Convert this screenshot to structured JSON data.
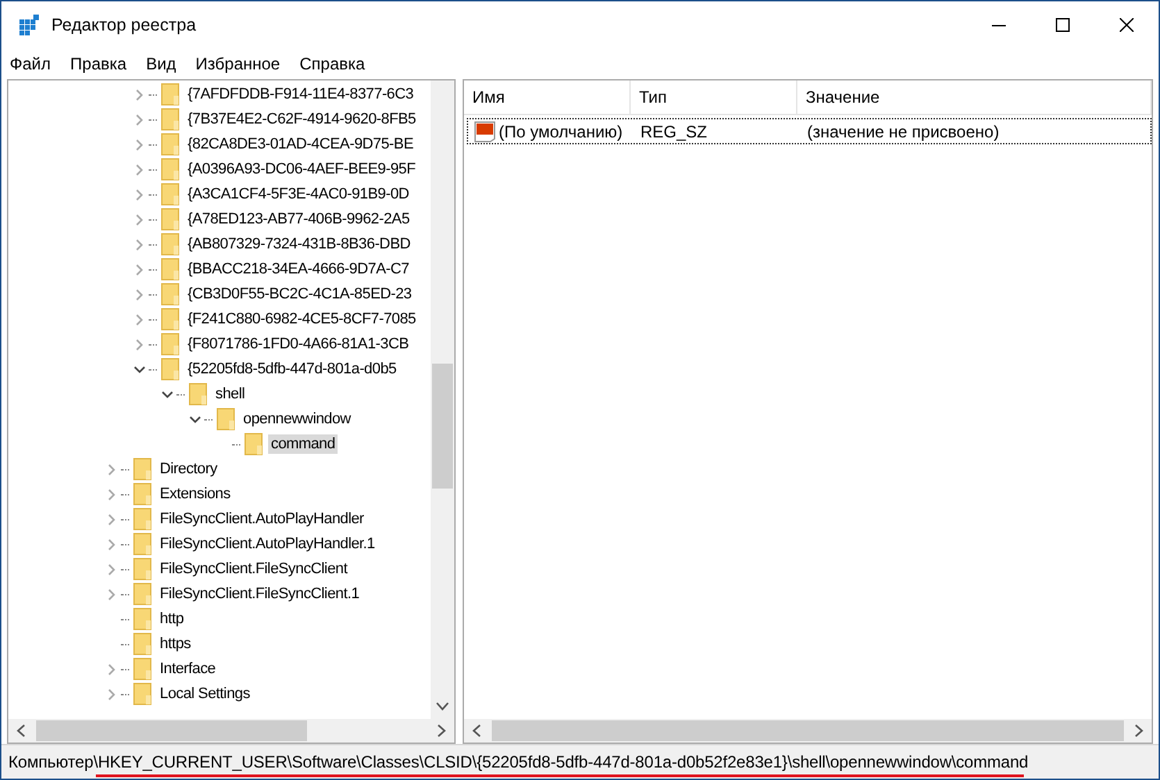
{
  "window": {
    "title": "Редактор реестра"
  },
  "menu": [
    "Файл",
    "Правка",
    "Вид",
    "Избранное",
    "Справка"
  ],
  "tree": {
    "clsid_subkeys": [
      {
        "label": "{7AFDFDDB-F914-11E4-8377-6C3",
        "expandable": true,
        "expanded": false,
        "selected": false
      },
      {
        "label": "{7B37E4E2-C62F-4914-9620-8FB5",
        "expandable": true,
        "expanded": false,
        "selected": false
      },
      {
        "label": "{82CA8DE3-01AD-4CEA-9D75-BE",
        "expandable": true,
        "expanded": false,
        "selected": false
      },
      {
        "label": "{A0396A93-DC06-4AEF-BEE9-95F",
        "expandable": true,
        "expanded": false,
        "selected": false
      },
      {
        "label": "{A3CA1CF4-5F3E-4AC0-91B9-0D",
        "expandable": true,
        "expanded": false,
        "selected": false
      },
      {
        "label": "{A78ED123-AB77-406B-9962-2A5",
        "expandable": true,
        "expanded": false,
        "selected": false
      },
      {
        "label": "{AB807329-7324-431B-8B36-DBD",
        "expandable": true,
        "expanded": false,
        "selected": false
      },
      {
        "label": "{BBACC218-34EA-4666-9D7A-C7",
        "expandable": true,
        "expanded": false,
        "selected": false
      },
      {
        "label": "{CB3D0F55-BC2C-4C1A-85ED-23",
        "expandable": true,
        "expanded": false,
        "selected": false
      },
      {
        "label": "{F241C880-6982-4CE5-8CF7-7085",
        "expandable": true,
        "expanded": false,
        "selected": false
      },
      {
        "label": "{F8071786-1FD0-4A66-81A1-3CB",
        "expandable": true,
        "expanded": false,
        "selected": false
      },
      {
        "label": "{52205fd8-5dfb-447d-801a-d0b5",
        "expandable": true,
        "expanded": true,
        "selected": false,
        "children": [
          {
            "label": "shell",
            "expandable": true,
            "expanded": true,
            "selected": false,
            "children": [
              {
                "label": "opennewwindow",
                "expandable": true,
                "expanded": true,
                "selected": false,
                "children": [
                  {
                    "label": "command",
                    "expandable": false,
                    "selected": true
                  }
                ]
              }
            ]
          }
        ]
      }
    ],
    "class_keys": [
      {
        "label": "Directory",
        "expandable": true,
        "expanded": false,
        "selected": false
      },
      {
        "label": "Extensions",
        "expandable": true,
        "expanded": false,
        "selected": false
      },
      {
        "label": "FileSyncClient.AutoPlayHandler",
        "expandable": true,
        "expanded": false,
        "selected": false
      },
      {
        "label": "FileSyncClient.AutoPlayHandler.1",
        "expandable": true,
        "expanded": false,
        "selected": false
      },
      {
        "label": "FileSyncClient.FileSyncClient",
        "expandable": true,
        "expanded": false,
        "selected": false
      },
      {
        "label": "FileSyncClient.FileSyncClient.1",
        "expandable": true,
        "expanded": false,
        "selected": false
      },
      {
        "label": "http",
        "expandable": false,
        "selected": false
      },
      {
        "label": "https",
        "expandable": false,
        "selected": false
      },
      {
        "label": "Interface",
        "expandable": true,
        "expanded": false,
        "selected": false
      },
      {
        "label": "Local Settings",
        "expandable": true,
        "expanded": false,
        "selected": false
      }
    ]
  },
  "table": {
    "columns": [
      "Имя",
      "Тип",
      "Значение"
    ],
    "rows": [
      {
        "name": "(По умолчанию)",
        "type": "REG_SZ",
        "value": "(значение не присвоено)",
        "selected": false
      }
    ]
  },
  "status_bar": {
    "path": "Компьютер\\HKEY_CURRENT_USER\\Software\\Classes\\CLSID\\{52205fd8-5dfb-447d-801a-d0b52f2e83e1}\\shell\\opennewwindow\\command"
  }
}
